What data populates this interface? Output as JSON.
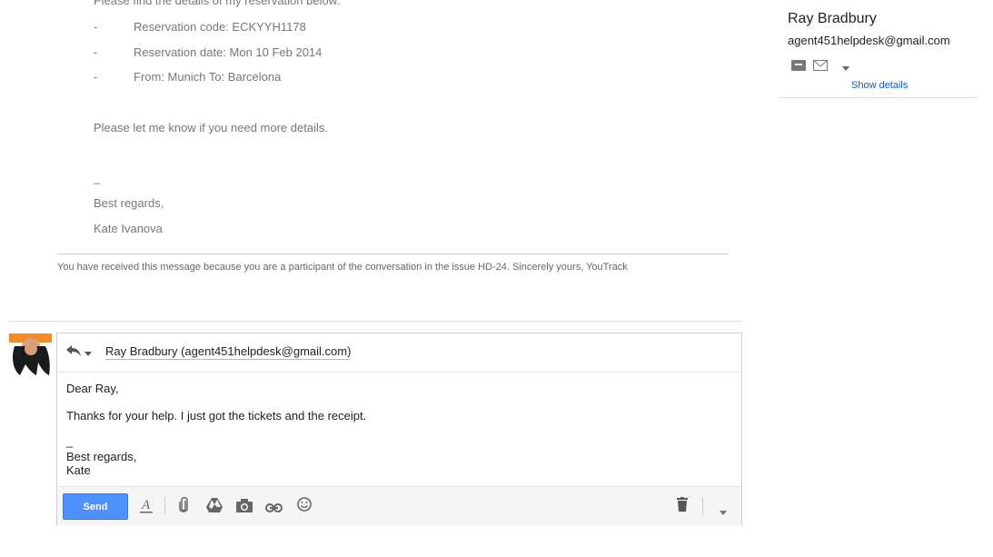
{
  "quoted": {
    "intro": "Please find the details of my reservation below:",
    "bullets": [
      {
        "dash": "-",
        "text": "Reservation code: ECKYYH1178"
      },
      {
        "dash": "-",
        "text": "Reservation date: Mon 10 Feb 2014"
      },
      {
        "dash": "-",
        "text": "From: Munich To: Barcelona"
      }
    ],
    "closing": "Please let me know if you need more details.",
    "sig_dash": "_",
    "regards": "Best regards,",
    "name": "Kate Ivanova"
  },
  "footer_note": "You have received this message because you are a participant of the conversation in the issue HD-24. Sincerely yours, YouTrack",
  "sidebar": {
    "name": "Ray Bradbury",
    "email": "agent451helpdesk@gmail.com",
    "show_details": "Show details"
  },
  "compose": {
    "recipient": "Ray Bradbury (agent451helpdesk@gmail.com)",
    "greeting": "Dear Ray,",
    "body": "Thanks for your help. I just got the tickets and the receipt.",
    "sig_dash": "_",
    "regards": "Best regards,",
    "name": "Kate",
    "send_label": "Send"
  },
  "icons": [
    "archive-icon",
    "envelope-icon",
    "dropdown-icon",
    "reply-icon",
    "formatting-icon",
    "attach-icon",
    "drive-icon",
    "photo-icon",
    "link-icon",
    "emoji-icon",
    "trash-icon",
    "more-options-icon"
  ],
  "colors": {
    "accent_blue": "#4d90fe",
    "link": "#15c",
    "underline": "#f1b04c"
  }
}
